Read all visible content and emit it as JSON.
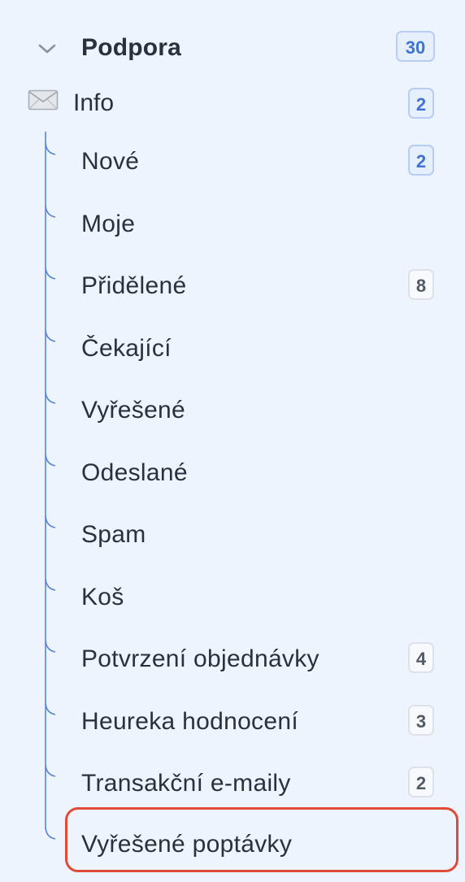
{
  "sidebar": {
    "group": {
      "title": "Podpora",
      "count": "30"
    },
    "account": {
      "label": "Info",
      "count": "2"
    },
    "folders": [
      {
        "label": "Nové",
        "count": "2",
        "badge_style": "blue"
      },
      {
        "label": "Moje",
        "count": null
      },
      {
        "label": "Přidělené",
        "count": "8",
        "badge_style": "gray"
      },
      {
        "label": "Čekající",
        "count": null
      },
      {
        "label": "Vyřešené",
        "count": null
      },
      {
        "label": "Odeslané",
        "count": null
      },
      {
        "label": "Spam",
        "count": null
      },
      {
        "label": "Koš",
        "count": null
      },
      {
        "label": "Potvrzení objednávky",
        "count": "4",
        "badge_style": "gray"
      },
      {
        "label": "Heureka hodnocení",
        "count": "3",
        "badge_style": "gray"
      },
      {
        "label": "Transakční e-maily",
        "count": "2",
        "badge_style": "gray"
      },
      {
        "label": "Vyřešené poptávky",
        "count": null,
        "highlighted": true
      }
    ]
  },
  "icons": {
    "group_toggle": "chevron-down-icon",
    "account": "envelope-icon"
  },
  "colors": {
    "background": "#edf4fd",
    "tree_line": "#5a86d8",
    "badge_blue_text": "#3f74d4",
    "highlight_border": "#e04b37"
  }
}
